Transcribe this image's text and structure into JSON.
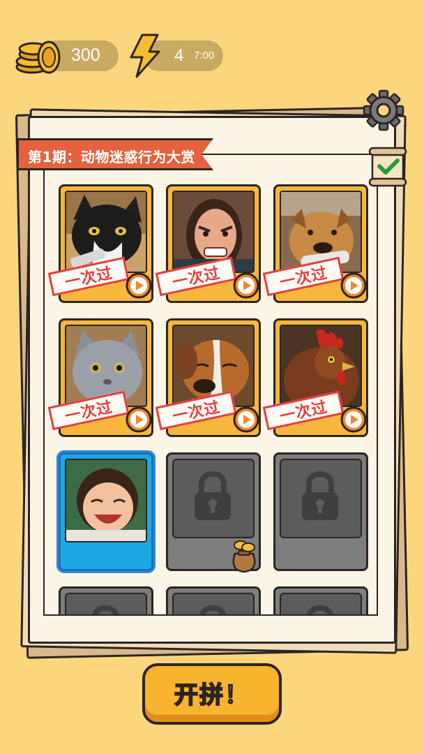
{
  "hud": {
    "coins": "300",
    "energy": "4",
    "energy_timer": "7:00"
  },
  "board": {
    "title": "第1期：动物迷惑行为大赏"
  },
  "levels": [
    {
      "status": "completed",
      "subject": "cat",
      "stamp": "一次过"
    },
    {
      "status": "completed",
      "subject": "woman",
      "stamp": "一次过"
    },
    {
      "status": "completed",
      "subject": "dog",
      "stamp": "一次过"
    },
    {
      "status": "completed",
      "subject": "grey-cat",
      "stamp": "一次过"
    },
    {
      "status": "completed",
      "subject": "beagle",
      "stamp": "一次过"
    },
    {
      "status": "completed",
      "subject": "rooster",
      "stamp": "一次过"
    },
    {
      "status": "current",
      "subject": "baby"
    },
    {
      "status": "locked",
      "reward": "coin-bag"
    },
    {
      "status": "locked"
    },
    {
      "status": "locked"
    },
    {
      "status": "locked"
    },
    {
      "status": "locked"
    }
  ],
  "start_button": {
    "label": "开拼！"
  },
  "colors": {
    "background": "#fbd67c",
    "ribbon": "#e4623d",
    "card_done": "#f6b73c",
    "card_current": "#1ea7e6",
    "card_locked": "#7d7d7d",
    "stamp_red": "#e53d3d",
    "button": "#f8b32f"
  },
  "icons": [
    "coins-icon",
    "lightning-icon",
    "gear-icon",
    "scroll-check-icon",
    "play-icon",
    "lock-icon",
    "coin-bag-icon"
  ]
}
